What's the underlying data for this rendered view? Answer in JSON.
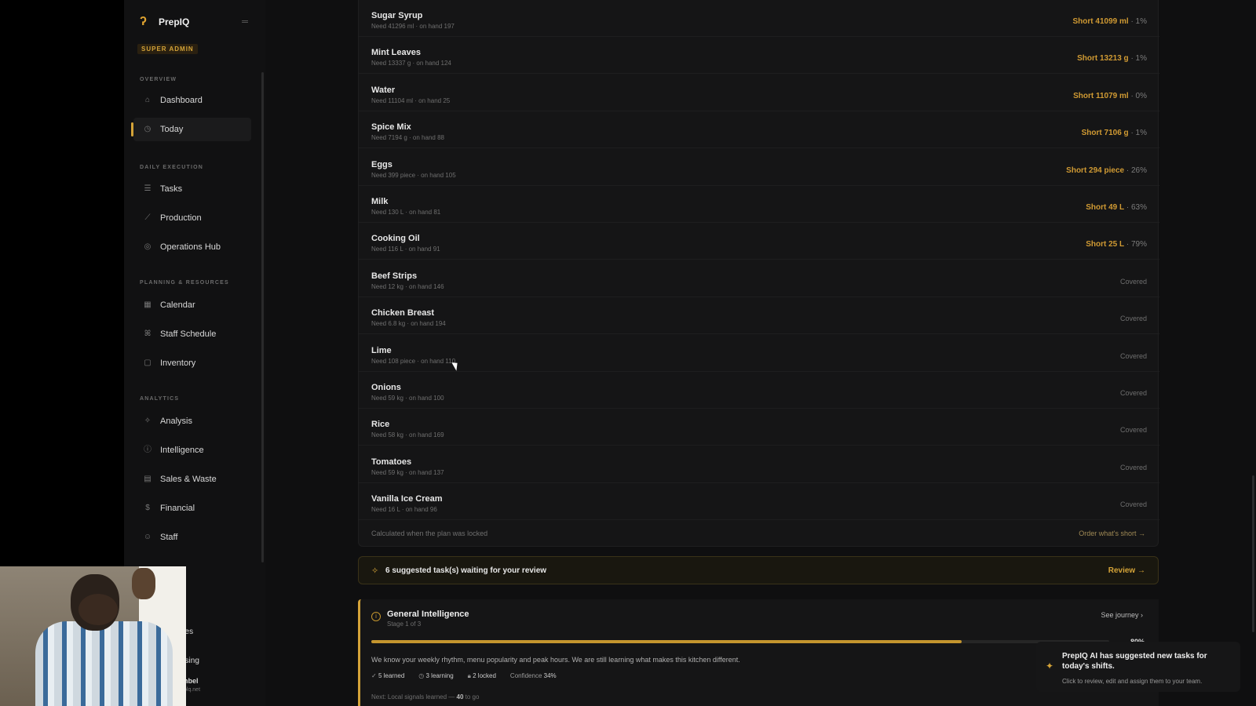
{
  "app": {
    "name": "PrepIQ",
    "role_badge": "SUPER ADMIN"
  },
  "sidebar": {
    "sections": [
      {
        "label": "OVERVIEW"
      },
      {
        "label": "DAILY EXECUTION"
      },
      {
        "label": "PLANNING & RESOURCES"
      },
      {
        "label": "ANALYTICS"
      }
    ],
    "items": [
      {
        "label": "Dashboard",
        "icon": "dashboard-icon"
      },
      {
        "label": "Today",
        "icon": "clock-icon",
        "active": true
      },
      {
        "label": "Tasks",
        "icon": "list-icon"
      },
      {
        "label": "Production",
        "icon": "chart-line-icon"
      },
      {
        "label": "Operations Hub",
        "icon": "hub-icon"
      },
      {
        "label": "Calendar",
        "icon": "calendar-icon"
      },
      {
        "label": "Staff Schedule",
        "icon": "people-icon"
      },
      {
        "label": "Inventory",
        "icon": "box-icon"
      },
      {
        "label": "Analysis",
        "icon": "sparkle-icon"
      },
      {
        "label": "Intelligence",
        "icon": "info-icon"
      },
      {
        "label": "Sales & Waste",
        "icon": "grid-icon"
      },
      {
        "label": "Financial",
        "icon": "money-icon"
      },
      {
        "label": "Staff",
        "icon": "user-icon"
      }
    ],
    "partial_items": [
      "y",
      "nes",
      "asing",
      "nbel",
      "plq.net"
    ]
  },
  "inventory": {
    "rows": [
      {
        "name": "Sugar Syrup",
        "need": "Need 41296 ml · on hand 197",
        "short": "Short 41099 ml",
        "pct": "· 1%"
      },
      {
        "name": "Mint Leaves",
        "need": "Need 13337 g · on hand 124",
        "short": "Short 13213 g",
        "pct": "· 1%"
      },
      {
        "name": "Water",
        "need": "Need 11104 ml · on hand 25",
        "short": "Short 11079 ml",
        "pct": "· 0%"
      },
      {
        "name": "Spice Mix",
        "need": "Need 7194 g · on hand 88",
        "short": "Short 7106 g",
        "pct": "· 1%"
      },
      {
        "name": "Eggs",
        "need": "Need 399 piece · on hand 105",
        "short": "Short 294 piece",
        "pct": "· 26%"
      },
      {
        "name": "Milk",
        "need": "Need 130 L · on hand 81",
        "short": "Short 49 L",
        "pct": "· 63%"
      },
      {
        "name": "Cooking Oil",
        "need": "Need 116 L · on hand 91",
        "short": "Short 25 L",
        "pct": "· 79%"
      },
      {
        "name": "Beef Strips",
        "need": "Need 12 kg · on hand 146",
        "covered": "Covered"
      },
      {
        "name": "Chicken Breast",
        "need": "Need 6.8 kg · on hand 194",
        "covered": "Covered"
      },
      {
        "name": "Lime",
        "need": "Need 108 piece · on hand 110",
        "covered": "Covered"
      },
      {
        "name": "Onions",
        "need": "Need 59 kg · on hand 100",
        "covered": "Covered"
      },
      {
        "name": "Rice",
        "need": "Need 58 kg · on hand 169",
        "covered": "Covered"
      },
      {
        "name": "Tomatoes",
        "need": "Need 59 kg · on hand 137",
        "covered": "Covered"
      },
      {
        "name": "Vanilla Ice Cream",
        "need": "Need 16 L · on hand 96",
        "covered": "Covered"
      }
    ],
    "footer_note": "Calculated when the plan was locked",
    "order_link": "Order what's short →"
  },
  "suggestions": {
    "text": "6 suggested task(s) waiting for your review",
    "review_label": "Review →"
  },
  "general_intelligence": {
    "title": "General Intelligence",
    "stage": "Stage 1 of 3",
    "journey_label": "See journey ›",
    "progress_pct": 80,
    "progress_text": "80%",
    "description": "We know your weekly rhythm, menu popularity and peak hours. We are still learning what makes this kitchen different.",
    "stats": {
      "learned": "5 learned",
      "learning": "3 learning",
      "locked": "2 locked",
      "confidence_label": "Confidence",
      "confidence_value": "34%"
    },
    "next_label": "Next: Local signals learned —",
    "next_value": "40",
    "next_suffix": "to go"
  },
  "toast": {
    "title": "PrepIQ AI has suggested new tasks for today's shifts.",
    "subtitle": "Click to review, edit and assign them to your team."
  },
  "colors": {
    "accent": "#d4a338",
    "short": "#d09a33"
  }
}
